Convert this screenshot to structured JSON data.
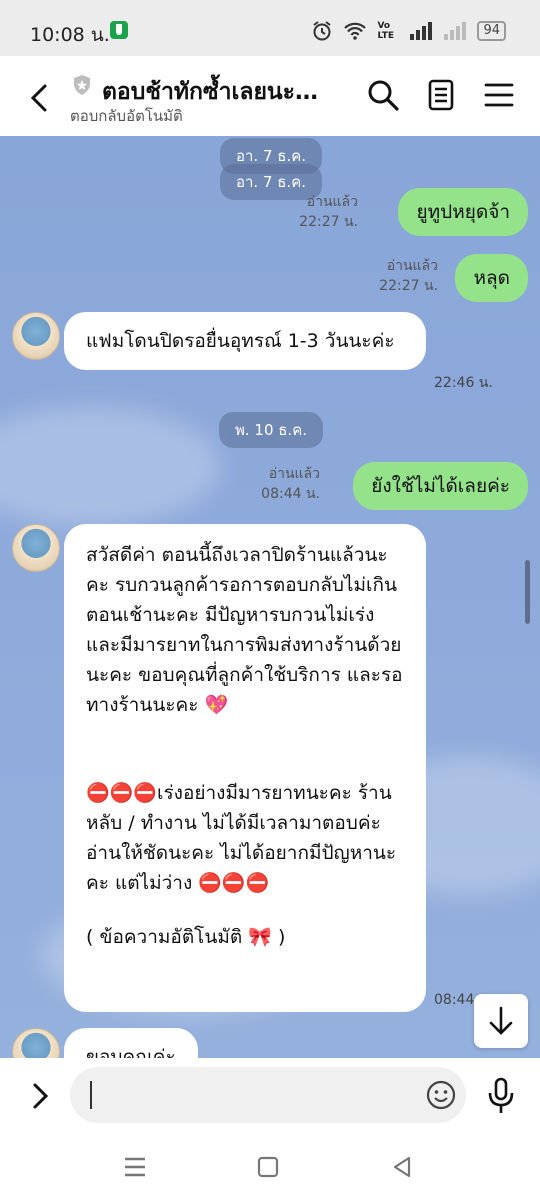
{
  "status_bar": {
    "time": "10:08 น.",
    "network_label": "Vo LTE",
    "battery": "94"
  },
  "header": {
    "title": "ตอบช้าทักซ้ำเลยนะ…",
    "subtitle": "ตอบกลับอัตโนมัติ"
  },
  "chat": {
    "date_1": "อา. 7 ธ.ค.",
    "date_1_dup": "อา. 7 ธ.ค.",
    "messages_1": [
      {
        "text": "ยูทูปหยุดจ้า",
        "read": "อ่านแล้ว",
        "time": "22:27 น."
      },
      {
        "text": "หลุด",
        "read": "อ่านแล้ว",
        "time": "22:27 น."
      }
    ],
    "incoming_1": {
      "text": "แฟมโดนปิดรอยื่นอุทรณ์ 1-3 วันนะค่ะ",
      "time": "22:46 น."
    },
    "date_2": "พ. 10 ธ.ค.",
    "out_2": {
      "text": "ยังใช้ไม่ได้เลยค่ะ",
      "read": "อ่านแล้ว",
      "time": "08:44 น."
    },
    "auto_reply": {
      "p1": "สวัสดีค่า ตอนนี้ถึงเวลาปิดร้านแล้วนะคะ รบกวนลูกค้ารอการตอบกลับไม่เกินตอนเช้านะคะ มีปัญหารบกวนไม่เร่ง และมีมารยาทในการพิมส่งทางร้านด้วยนะคะ ขอบคุณที่ลูกค้าใช้บริการ และรอทางร้านนะคะ 💖",
      "p2": "⛔⛔⛔เร่งอย่างมีมารยาทนะคะ ร้านหลับ / ทำงาน ไม่ได้มีเวลามาตอบค่ะ อ่านให้ชัดนะคะ ไม่ได้อยากมีปัญหานะคะ แต่ไม่ว่าง ⛔⛔⛔",
      "p3": "( ข้อความอัติโนมัติ 🎀 )",
      "time": "08:44"
    },
    "partial_message": "ขอบคุณค่ะ"
  }
}
